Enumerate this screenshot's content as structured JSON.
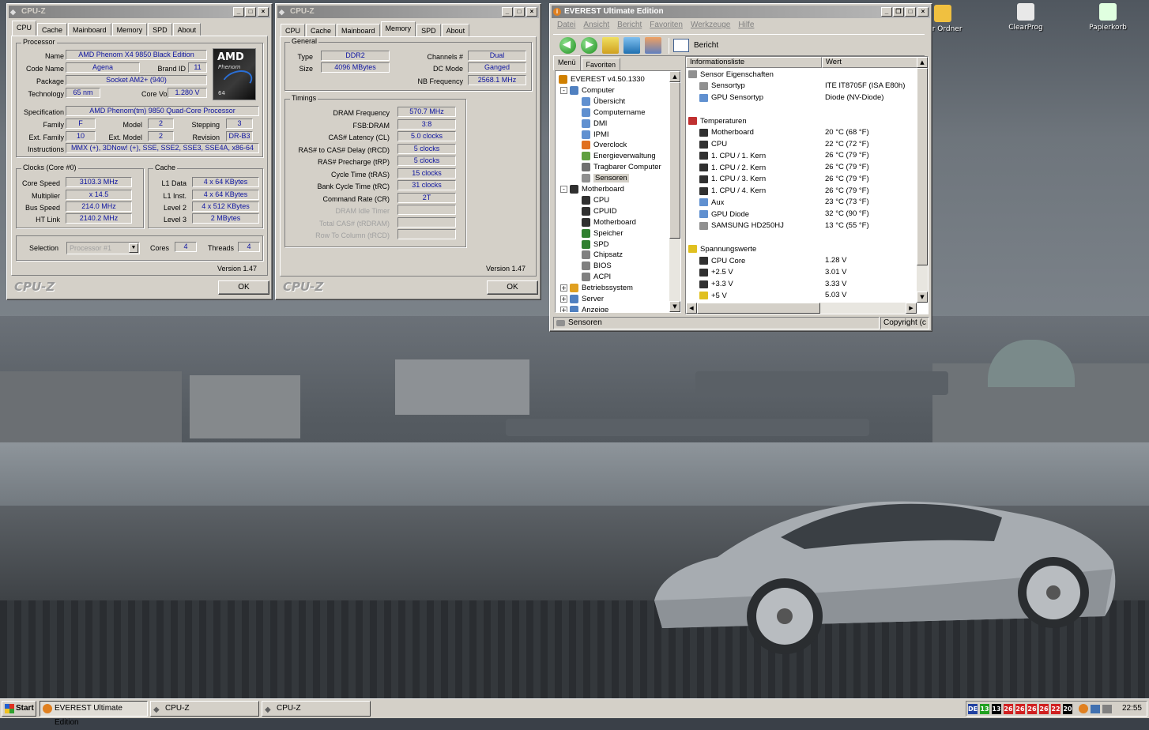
{
  "desktop": {
    "icons": [
      {
        "label": "uer Ordner",
        "icon": "folder-icon",
        "color": "#f0c040"
      },
      {
        "label": "ClearProg",
        "icon": "recycle-icon",
        "color": "#e8e8e8"
      },
      {
        "label": "Papierkorb",
        "icon": "recycle-bin-icon",
        "color": "#e0ffe0"
      }
    ]
  },
  "cpuz1": {
    "title": "CPU-Z",
    "tabs": [
      "CPU",
      "Cache",
      "Mainboard",
      "Memory",
      "SPD",
      "About"
    ],
    "active_tab": "CPU",
    "processor": {
      "group": "Processor",
      "name_label": "Name",
      "name": "AMD Phenom X4 9850 Black Edition",
      "code_label": "Code Name",
      "code": "Agena",
      "brand_label": "Brand ID",
      "brand": "11",
      "package_label": "Package",
      "package": "Socket AM2+ (940)",
      "tech_label": "Technology",
      "tech": "65 nm",
      "voltage_label": "Core Voltage",
      "voltage": "1.280 V",
      "spec_label": "Specification",
      "spec": "AMD Phenom(tm) 9850 Quad-Core Processor",
      "family_label": "Family",
      "family": "F",
      "model_label": "Model",
      "model": "2",
      "stepping_label": "Stepping",
      "stepping": "3",
      "extfam_label": "Ext. Family",
      "extfam": "10",
      "extmodel_label": "Ext. Model",
      "extmodel": "2",
      "revision_label": "Revision",
      "revision": "DR-B3",
      "instr_label": "Instructions",
      "instr": "MMX (+), 3DNow! (+), SSE, SSE2, SSE3, SSE4A, x86-64",
      "logo": {
        "brand": "AMD",
        "line": "Phenom",
        "bits": "64"
      }
    },
    "clocks": {
      "group": "Clocks (Core #0)",
      "speed_label": "Core Speed",
      "speed": "3103.3 MHz",
      "mult_label": "Multiplier",
      "mult": "x 14.5",
      "bus_label": "Bus Speed",
      "bus": "214.0 MHz",
      "ht_label": "HT Link",
      "ht": "2140.2 MHz"
    },
    "cache": {
      "group": "Cache",
      "l1d_label": "L1 Data",
      "l1d": "4 x 64 KBytes",
      "l1i_label": "L1 Inst.",
      "l1i": "4 x 64 KBytes",
      "l2_label": "Level 2",
      "l2": "4 x 512 KBytes",
      "l3_label": "Level 3",
      "l3": "2 MBytes"
    },
    "selection_label": "Selection",
    "selection": "Processor #1",
    "cores_label": "Cores",
    "cores": "4",
    "threads_label": "Threads",
    "threads": "4",
    "version": "Version 1.47",
    "brand": "CPU-Z",
    "ok": "OK"
  },
  "cpuz2": {
    "title": "CPU-Z",
    "tabs": [
      "CPU",
      "Cache",
      "Mainboard",
      "Memory",
      "SPD",
      "About"
    ],
    "active_tab": "Memory",
    "general": {
      "group": "General",
      "type_label": "Type",
      "type": "DDR2",
      "channels_label": "Channels #",
      "channels": "Dual",
      "size_label": "Size",
      "size": "4096 MBytes",
      "dc_label": "DC Mode",
      "dc": "Ganged",
      "nb_label": "NB Frequency",
      "nb": "2568.1 MHz"
    },
    "timings": {
      "group": "Timings",
      "rows": [
        {
          "label": "DRAM Frequency",
          "value": "570.7 MHz",
          "disabled": false
        },
        {
          "label": "FSB:DRAM",
          "value": "3:8",
          "disabled": false
        },
        {
          "label": "CAS# Latency (CL)",
          "value": "5.0 clocks",
          "disabled": false
        },
        {
          "label": "RAS# to CAS# Delay (tRCD)",
          "value": "5 clocks",
          "disabled": false
        },
        {
          "label": "RAS# Precharge (tRP)",
          "value": "5 clocks",
          "disabled": false
        },
        {
          "label": "Cycle Time (tRAS)",
          "value": "15 clocks",
          "disabled": false
        },
        {
          "label": "Bank Cycle Time (tRC)",
          "value": "31 clocks",
          "disabled": false
        },
        {
          "label": "Command Rate (CR)",
          "value": "2T",
          "disabled": false
        },
        {
          "label": "DRAM Idle Timer",
          "value": "",
          "disabled": true
        },
        {
          "label": "Total CAS# (tRDRAM)",
          "value": "",
          "disabled": true
        },
        {
          "label": "Row To Column (tRCD)",
          "value": "",
          "disabled": true
        }
      ]
    },
    "version": "Version 1.47",
    "brand": "CPU-Z",
    "ok": "OK"
  },
  "everest": {
    "title": "EVEREST Ultimate Edition",
    "menu": [
      "Datei",
      "Ansicht",
      "Bericht",
      "Favoriten",
      "Werkzeuge",
      "Hilfe"
    ],
    "toolbar_report": "Bericht",
    "left_tabs": [
      "Menü",
      "Favoriten"
    ],
    "tree": [
      {
        "label": "EVEREST v4.50.1330",
        "level": 0,
        "icon": "info-icon",
        "color": "#d08000",
        "exp": ""
      },
      {
        "label": "Computer",
        "level": 1,
        "icon": "computer-icon",
        "color": "#5080c0",
        "exp": "-"
      },
      {
        "label": "Übersicht",
        "level": 2,
        "icon": "info-icon",
        "color": "#6090d0",
        "exp": ""
      },
      {
        "label": "Computername",
        "level": 2,
        "icon": "computer-icon",
        "color": "#6090d0",
        "exp": ""
      },
      {
        "label": "DMI",
        "level": 2,
        "icon": "dmi-icon",
        "color": "#6090d0",
        "exp": ""
      },
      {
        "label": "IPMI",
        "level": 2,
        "icon": "ipmi-icon",
        "color": "#6090d0",
        "exp": ""
      },
      {
        "label": "Overclock",
        "level": 2,
        "icon": "overclock-icon",
        "color": "#e07020",
        "exp": ""
      },
      {
        "label": "Energieverwaltung",
        "level": 2,
        "icon": "power-icon",
        "color": "#60a040",
        "exp": ""
      },
      {
        "label": "Tragbarer Computer",
        "level": 2,
        "icon": "laptop-icon",
        "color": "#707070",
        "exp": ""
      },
      {
        "label": "Sensoren",
        "level": 2,
        "icon": "sensor-icon",
        "color": "#909090",
        "exp": "",
        "selected": true
      },
      {
        "label": "Motherboard",
        "level": 1,
        "icon": "motherboard-icon",
        "color": "#303030",
        "exp": "-"
      },
      {
        "label": "CPU",
        "level": 2,
        "icon": "cpu-icon",
        "color": "#303030",
        "exp": ""
      },
      {
        "label": "CPUID",
        "level": 2,
        "icon": "cpu-icon",
        "color": "#303030",
        "exp": ""
      },
      {
        "label": "Motherboard",
        "level": 2,
        "icon": "motherboard-icon",
        "color": "#303030",
        "exp": ""
      },
      {
        "label": "Speicher",
        "level": 2,
        "icon": "memory-icon",
        "color": "#308030",
        "exp": ""
      },
      {
        "label": "SPD",
        "level": 2,
        "icon": "memory-icon",
        "color": "#308030",
        "exp": ""
      },
      {
        "label": "Chipsatz",
        "level": 2,
        "icon": "chipset-icon",
        "color": "#808080",
        "exp": ""
      },
      {
        "label": "BIOS",
        "level": 2,
        "icon": "bios-icon",
        "color": "#808080",
        "exp": ""
      },
      {
        "label": "ACPI",
        "level": 2,
        "icon": "acpi-icon",
        "color": "#808080",
        "exp": ""
      },
      {
        "label": "Betriebssystem",
        "level": 1,
        "icon": "os-icon",
        "color": "#e0a020",
        "exp": "+"
      },
      {
        "label": "Server",
        "level": 1,
        "icon": "server-icon",
        "color": "#5080c0",
        "exp": "+"
      },
      {
        "label": "Anzeige",
        "level": 1,
        "icon": "display-icon",
        "color": "#5080c0",
        "exp": "+"
      }
    ],
    "columns": [
      "Informationsliste",
      "Wert"
    ],
    "rows": [
      {
        "label": "Sensor Eigenschaften",
        "value": "",
        "level": 0,
        "icon": "sensor-icon",
        "color": "#909090"
      },
      {
        "label": "Sensortyp",
        "value": "ITE IT8705F  (ISA E80h)",
        "level": 1,
        "icon": "sensor-icon",
        "color": "#909090"
      },
      {
        "label": "GPU Sensortyp",
        "value": "Diode  (NV-Diode)",
        "level": 1,
        "icon": "gpu-icon",
        "color": "#6090d0"
      },
      {
        "label": "",
        "value": "",
        "level": 0,
        "icon": "",
        "color": ""
      },
      {
        "label": "Temperaturen",
        "value": "",
        "level": 0,
        "icon": "thermometer-icon",
        "color": "#c03030"
      },
      {
        "label": "Motherboard",
        "value": "20 °C  (68 °F)",
        "level": 1,
        "icon": "motherboard-icon",
        "color": "#303030"
      },
      {
        "label": "CPU",
        "value": "22 °C  (72 °F)",
        "level": 1,
        "icon": "cpu-icon",
        "color": "#303030"
      },
      {
        "label": "1. CPU / 1. Kern",
        "value": "26 °C  (79 °F)",
        "level": 1,
        "icon": "cpu-icon",
        "color": "#303030"
      },
      {
        "label": "1. CPU / 2. Kern",
        "value": "26 °C  (79 °F)",
        "level": 1,
        "icon": "cpu-icon",
        "color": "#303030"
      },
      {
        "label": "1. CPU / 3. Kern",
        "value": "26 °C  (79 °F)",
        "level": 1,
        "icon": "cpu-icon",
        "color": "#303030"
      },
      {
        "label": "1. CPU / 4. Kern",
        "value": "26 °C  (79 °F)",
        "level": 1,
        "icon": "cpu-icon",
        "color": "#303030"
      },
      {
        "label": "Aux",
        "value": "23 °C  (73 °F)",
        "level": 1,
        "icon": "aux-icon",
        "color": "#6090d0"
      },
      {
        "label": "GPU Diode",
        "value": "32 °C  (90 °F)",
        "level": 1,
        "icon": "gpu-icon",
        "color": "#6090d0"
      },
      {
        "label": "SAMSUNG HD250HJ",
        "value": "13 °C  (55 °F)",
        "level": 1,
        "icon": "harddisk-icon",
        "color": "#909090"
      },
      {
        "label": "",
        "value": "",
        "level": 0,
        "icon": "",
        "color": ""
      },
      {
        "label": "Spannungswerte",
        "value": "",
        "level": 0,
        "icon": "warning-icon",
        "color": "#e0c020"
      },
      {
        "label": "CPU Core",
        "value": "1.28 V",
        "level": 1,
        "icon": "cpu-icon",
        "color": "#303030"
      },
      {
        "label": "+2.5 V",
        "value": "3.01 V",
        "level": 1,
        "icon": "voltage-icon",
        "color": "#303030"
      },
      {
        "label": "+3.3 V",
        "value": "3.33 V",
        "level": 1,
        "icon": "voltage-icon",
        "color": "#303030"
      },
      {
        "label": "+5 V",
        "value": "5.03 V",
        "level": 1,
        "icon": "warning-icon",
        "color": "#e0c020"
      }
    ],
    "status_left": "Sensoren",
    "status_right": "Copyright (c"
  },
  "taskbar": {
    "start": "Start",
    "buttons": [
      {
        "label": "EVEREST Ultimate Edition",
        "icon": "everest-icon"
      },
      {
        "label": "CPU-Z",
        "icon": "cpuz-icon"
      },
      {
        "label": "CPU-Z",
        "icon": "cpuz-icon"
      }
    ],
    "tray_numbers": [
      {
        "text": "DE",
        "color": "#2040a0"
      },
      {
        "text": "13",
        "color": "#20a020"
      },
      {
        "text": "13",
        "color": "#000000"
      },
      {
        "text": "26",
        "color": "#d02020"
      },
      {
        "text": "26",
        "color": "#d02020"
      },
      {
        "text": "26",
        "color": "#d02020"
      },
      {
        "text": "26",
        "color": "#d02020"
      },
      {
        "text": "22",
        "color": "#d02020"
      },
      {
        "text": "20",
        "color": "#000000"
      }
    ],
    "clock": "22:55"
  }
}
